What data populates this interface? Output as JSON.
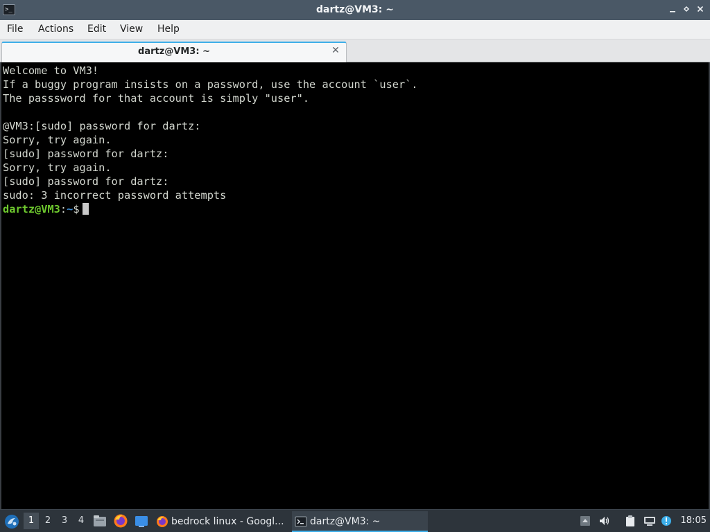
{
  "window": {
    "title": "dartz@VM3: ~",
    "controls": {
      "minimize": "minimize",
      "maximize": "restore",
      "close": "close"
    }
  },
  "menubar": {
    "items": [
      "File",
      "Actions",
      "Edit",
      "View",
      "Help"
    ]
  },
  "tabs": [
    {
      "label": "dartz@VM3: ~",
      "active": true
    }
  ],
  "terminal": {
    "lines": [
      "Welcome to VM3!",
      "If a buggy program insists on a password, use the account `user`.",
      "The passsword for that account is simply \"user\".",
      "",
      "@VM3:[sudo] password for dartz:",
      "Sorry, try again.",
      "[sudo] password for dartz:",
      "Sorry, try again.",
      "[sudo] password for dartz:",
      "sudo: 3 incorrect password attempts"
    ],
    "prompt": {
      "user_host": "dartz@VM3",
      "sep": ":",
      "path": "~",
      "symbol": "$"
    },
    "colors": {
      "background": "#000000",
      "text": "#d3d7cf",
      "user": "#6ec92e",
      "path": "#3e8fd6"
    }
  },
  "taskbar": {
    "workspaces": [
      "1",
      "2",
      "3",
      "4"
    ],
    "active_workspace": "1",
    "quicklaunch": [
      "file-manager-icon",
      "firefox-icon",
      "show-desktop-icon"
    ],
    "tasks": [
      {
        "icon": "firefox-icon",
        "label": "bedrock linux - Googl...",
        "active": false
      },
      {
        "icon": "terminal-icon",
        "label": "dartz@VM3: ~",
        "active": true
      }
    ],
    "tray": [
      "network-indicator-icon",
      "volume-icon",
      "clipboard-icon",
      "network-icon",
      "updates-icon"
    ],
    "clock": "18:05"
  }
}
